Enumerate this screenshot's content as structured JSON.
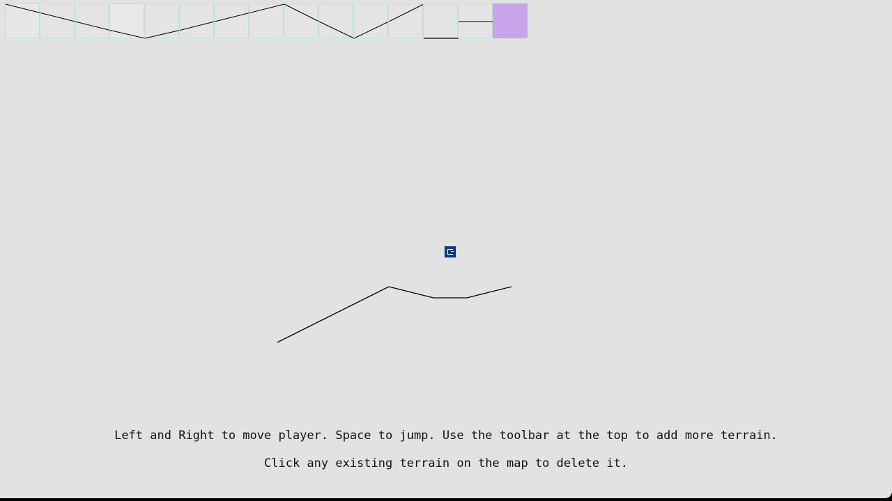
{
  "toolbar": {
    "tools": [
      {
        "name": "tool-slope-down-left-half"
      },
      {
        "name": "tool-slope-down-right-half"
      },
      {
        "name": "tool-slope-down-left-full"
      },
      {
        "name": "tool-slope-down-right-full"
      },
      {
        "name": "tool-slope-up-left-full"
      },
      {
        "name": "tool-slope-up-right-full"
      },
      {
        "name": "tool-slope-up-left-half"
      },
      {
        "name": "tool-slope-up-right-half"
      },
      {
        "name": "tool-steep-down-left"
      },
      {
        "name": "tool-steep-down-right"
      },
      {
        "name": "tool-steep-up-left"
      },
      {
        "name": "tool-steep-up-right"
      },
      {
        "name": "tool-flat-bottom"
      },
      {
        "name": "tool-flat-middle"
      },
      {
        "name": "tool-eraser",
        "selected": true
      }
    ],
    "selected_color": "#c9a4ea"
  },
  "player": {
    "color": "#0b3e8c"
  },
  "terrain": {
    "color": "#000000"
  },
  "instructions": {
    "line1": "Left and Right to move player. Space to jump. Use the toolbar at the top to add more terrain.",
    "line2": "Click any existing terrain on the map to delete it."
  }
}
